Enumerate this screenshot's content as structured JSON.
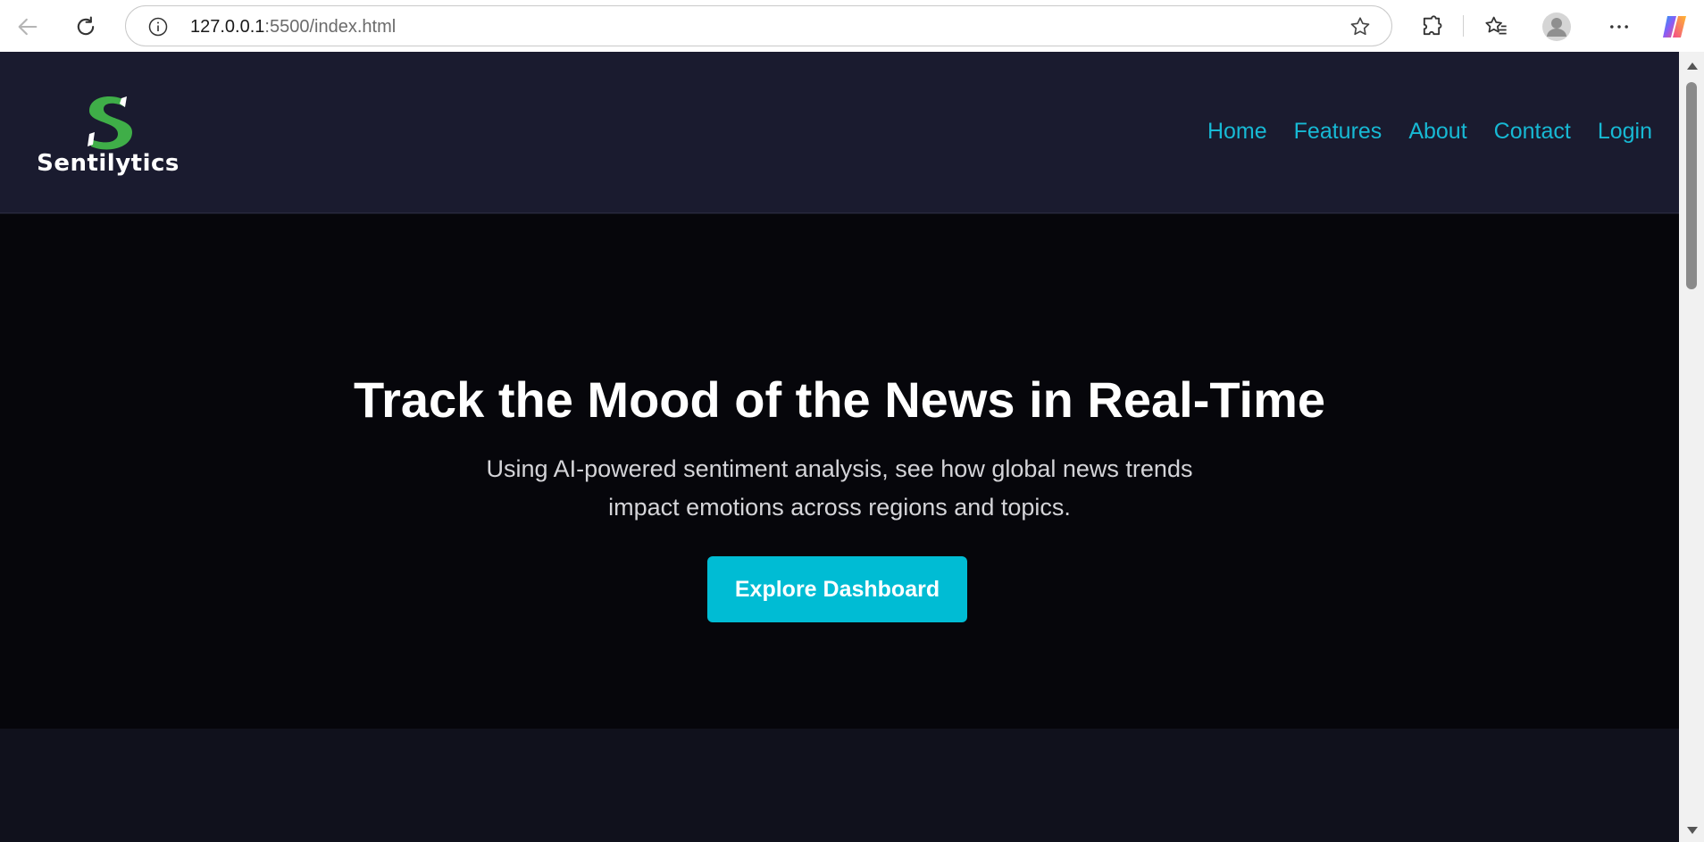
{
  "browser": {
    "url_host": "127.0.0.1",
    "url_rest": ":5500/index.html"
  },
  "site": {
    "logo_text": "Sentilytics",
    "nav": [
      "Home",
      "Features",
      "About",
      "Contact",
      "Login"
    ]
  },
  "hero": {
    "title": "Track the Mood of the News in Real-Time",
    "subtitle_line1": "Using AI-powered sentiment analysis, see how global news trends",
    "subtitle_line2": "impact emotions across regions and topics.",
    "cta": "Explore Dashboard"
  },
  "colors": {
    "header_bg": "#1a1b2f",
    "hero_bg": "#06060b",
    "accent": "#00bcd4",
    "nav_link": "#17b9d4",
    "logo_green": "#3fae48"
  },
  "icons": [
    "back-icon",
    "refresh-icon",
    "info-icon",
    "star-icon",
    "extensions-icon",
    "favorites-icon",
    "profile-icon",
    "more-icon",
    "copilot-icon"
  ]
}
